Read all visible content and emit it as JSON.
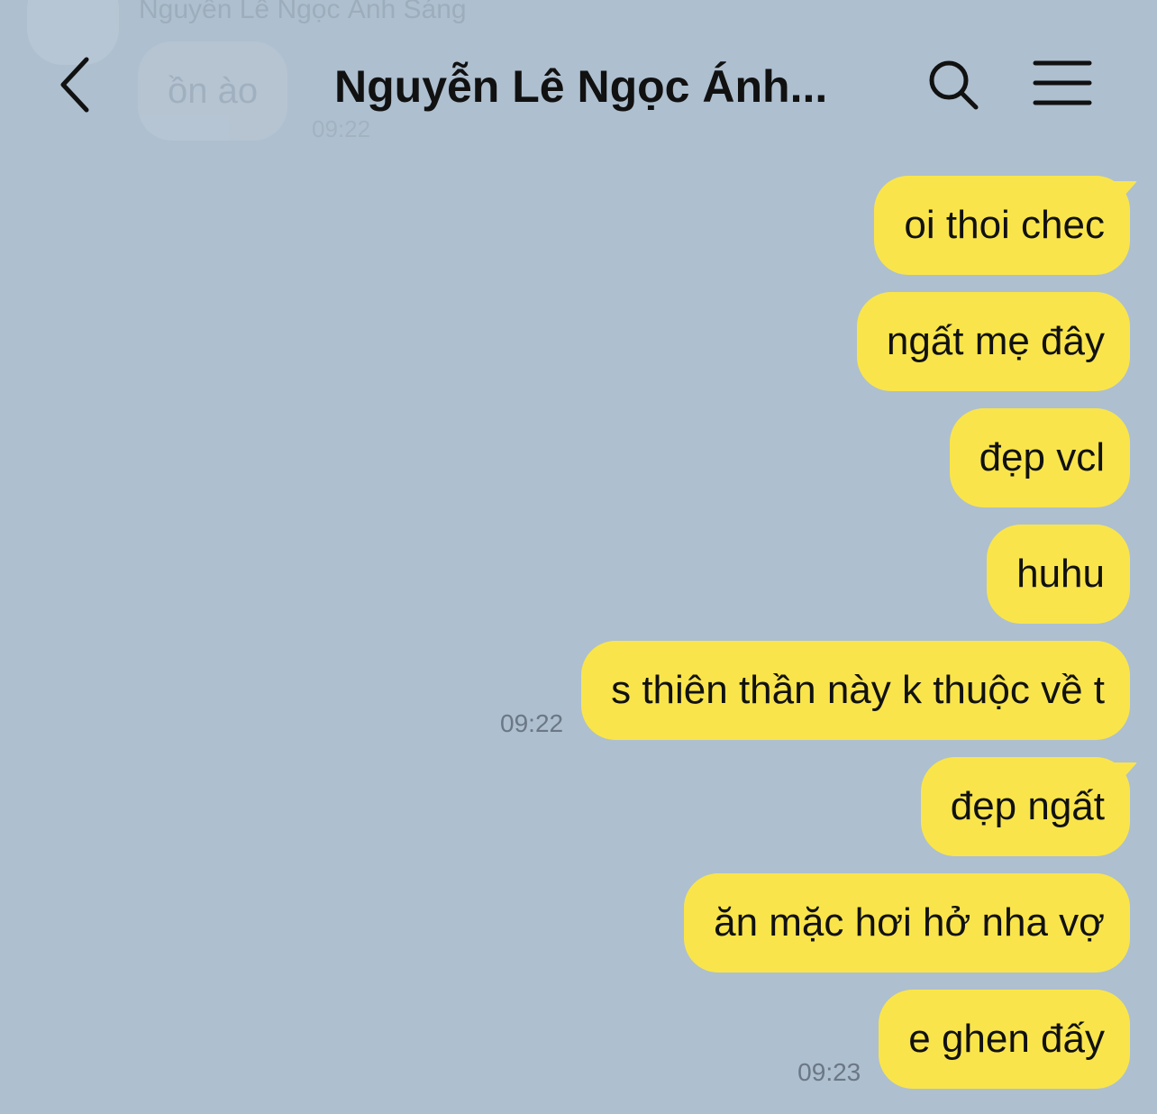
{
  "ghost": {
    "name": "Nguyễn Lê Ngọc Ánh Sáng",
    "message": "ồn ào",
    "time": "09:22"
  },
  "header": {
    "title": "Nguyễn Lê Ngọc Ánh...",
    "back_icon": "chevron-left-icon",
    "search_icon": "search-icon",
    "menu_icon": "hamburger-menu-icon"
  },
  "colors": {
    "background": "#aebfcf",
    "bubble": "#f9e54b",
    "text": "#111111",
    "time": "#6b7784"
  },
  "messages": [
    {
      "text": "oi thoi chec"
    },
    {
      "text": "ngất mẹ đây"
    },
    {
      "text": "đẹp vcl"
    },
    {
      "text": "huhu"
    },
    {
      "text": "s thiên thần này k thuộc về t",
      "time": "09:22"
    },
    {
      "text": "đẹp ngất"
    },
    {
      "text": "ăn mặc hơi hở nha vợ"
    },
    {
      "text": "e ghen đấy",
      "time": "09:23"
    }
  ]
}
